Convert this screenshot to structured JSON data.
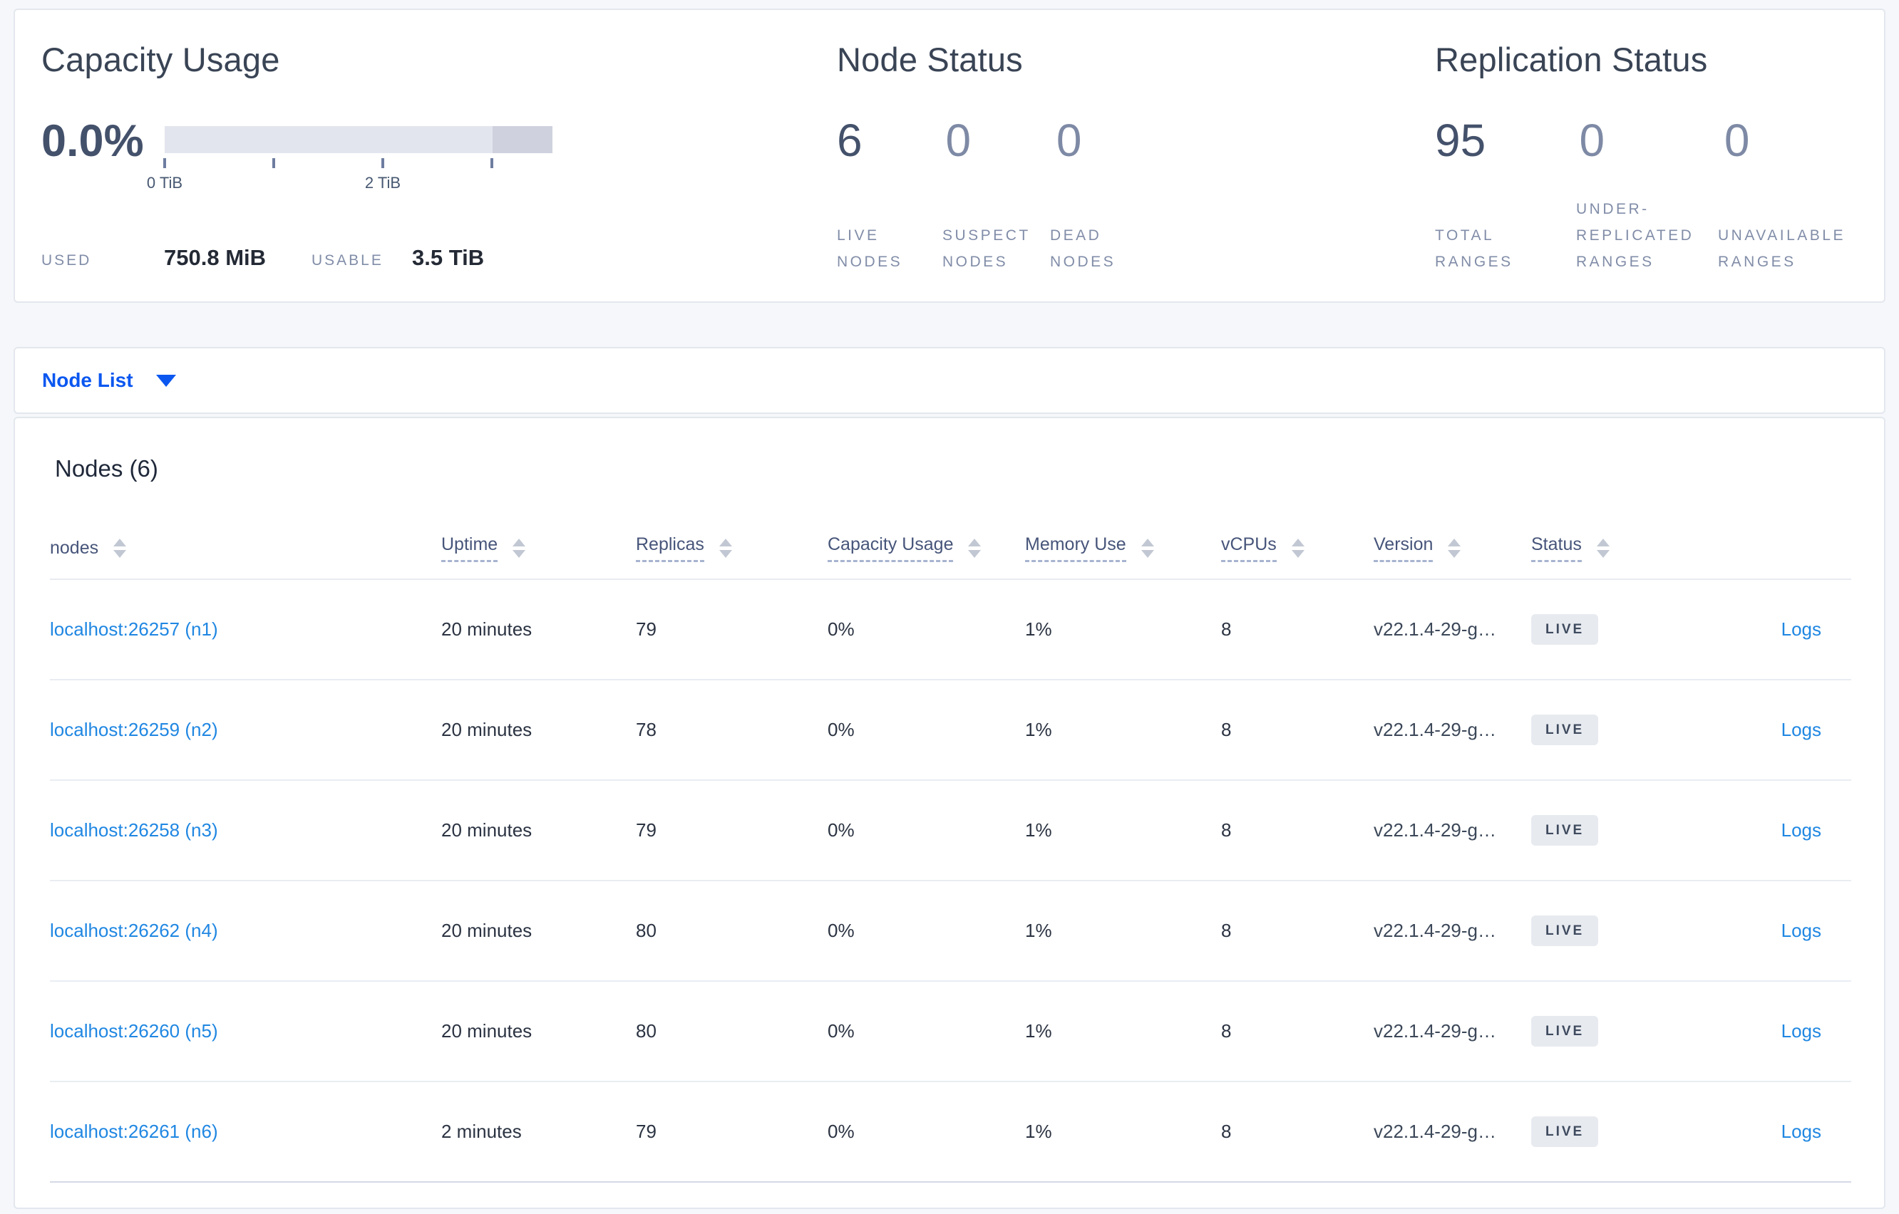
{
  "colors": {
    "page_background": "#f5f7fa",
    "accent_blue": "#0b57f0",
    "link_blue": "#2087e2",
    "bar_track": "#e3e5ee",
    "bar_segment": "#cfd2de",
    "badge_background": "#e7eaef",
    "badge_text": "#3e4a5e",
    "title_text": "#394455",
    "stat_zero_text": "#7e8aa5"
  },
  "summary": {
    "capacity": {
      "title": "Capacity Usage",
      "percent": "0.0%",
      "ticks": [
        "0 TiB",
        "2 TiB"
      ],
      "used_label": "USED",
      "used_value": "750.8 MiB",
      "usable_label": "USABLE",
      "usable_value": "3.5 TiB"
    },
    "node_status": {
      "title": "Node Status",
      "stats": [
        {
          "value": "6",
          "label": "LIVE NODES"
        },
        {
          "value": "0",
          "label": "SUSPECT NODES"
        },
        {
          "value": "0",
          "label": "DEAD NODES"
        }
      ]
    },
    "replication": {
      "title": "Replication Status",
      "stats": [
        {
          "value": "95",
          "label": "TOTAL RANGES"
        },
        {
          "value": "0",
          "label": "UNDER-REPLICATED RANGES"
        },
        {
          "value": "0",
          "label": "UNAVAILABLE RANGES"
        }
      ]
    }
  },
  "node_list": {
    "selector_label": "Node List"
  },
  "table": {
    "heading": "Nodes (6)",
    "columns": [
      "nodes",
      "Uptime",
      "Replicas",
      "Capacity Usage",
      "Memory Use",
      "vCPUs",
      "Version",
      "Status"
    ],
    "rows": [
      {
        "node": "localhost:26257 (n1)",
        "uptime": "20 minutes",
        "replicas": "79",
        "capacity": "0%",
        "memory": "1%",
        "vcpus": "8",
        "version": "v22.1.4-29-g…",
        "status": "LIVE",
        "logs": "Logs"
      },
      {
        "node": "localhost:26259 (n2)",
        "uptime": "20 minutes",
        "replicas": "78",
        "capacity": "0%",
        "memory": "1%",
        "vcpus": "8",
        "version": "v22.1.4-29-g…",
        "status": "LIVE",
        "logs": "Logs"
      },
      {
        "node": "localhost:26258 (n3)",
        "uptime": "20 minutes",
        "replicas": "79",
        "capacity": "0%",
        "memory": "1%",
        "vcpus": "8",
        "version": "v22.1.4-29-g…",
        "status": "LIVE",
        "logs": "Logs"
      },
      {
        "node": "localhost:26262 (n4)",
        "uptime": "20 minutes",
        "replicas": "80",
        "capacity": "0%",
        "memory": "1%",
        "vcpus": "8",
        "version": "v22.1.4-29-g…",
        "status": "LIVE",
        "logs": "Logs"
      },
      {
        "node": "localhost:26260 (n5)",
        "uptime": "20 minutes",
        "replicas": "80",
        "capacity": "0%",
        "memory": "1%",
        "vcpus": "8",
        "version": "v22.1.4-29-g…",
        "status": "LIVE",
        "logs": "Logs"
      },
      {
        "node": "localhost:26261 (n6)",
        "uptime": "2 minutes",
        "replicas": "79",
        "capacity": "0%",
        "memory": "1%",
        "vcpus": "8",
        "version": "v22.1.4-29-g…",
        "status": "LIVE",
        "logs": "Logs"
      }
    ]
  }
}
